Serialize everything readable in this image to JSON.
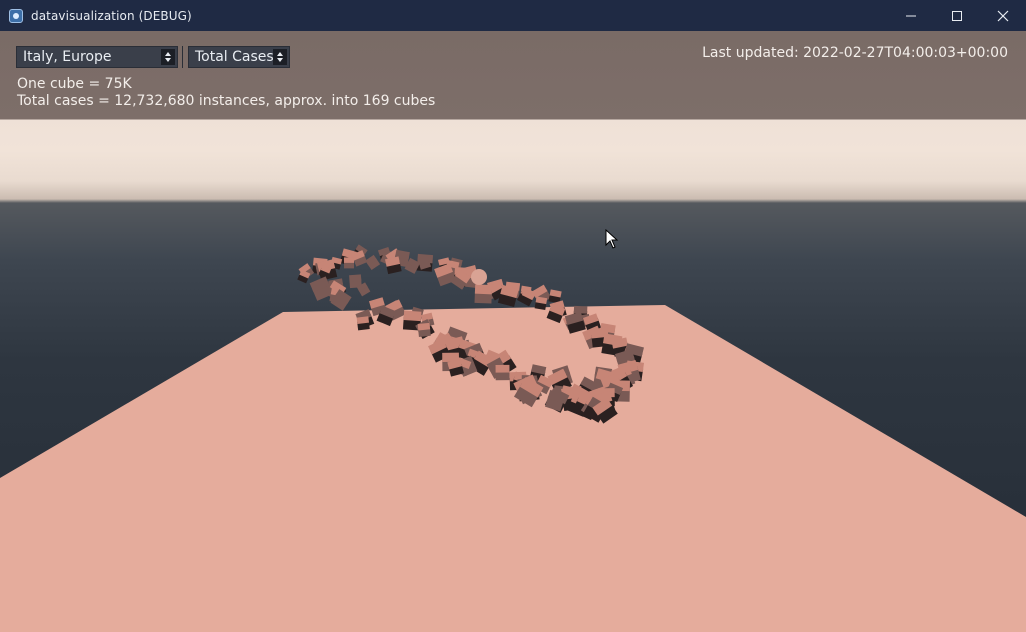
{
  "window": {
    "title": "datavisualization (DEBUG)",
    "controls": {
      "minimize_icon": "minimize-icon",
      "maximize_icon": "maximize-icon",
      "close_icon": "close-icon"
    }
  },
  "toolbar": {
    "region_select": {
      "value": "Italy, Europe"
    },
    "metric_select": {
      "value": "Total Cases"
    },
    "last_updated": "Last updated: 2022-02-27T04:00:03+00:00"
  },
  "info": {
    "cube_scale": "One cube = 75K",
    "total": "Total cases = 12,732,680 instances, approx. into 169 cubes"
  },
  "colors": {
    "floor": "#e5ac9c",
    "cube_top": "#c78576",
    "cube_side": "#7a5a55",
    "cube_shadow": "#2a2020"
  }
}
